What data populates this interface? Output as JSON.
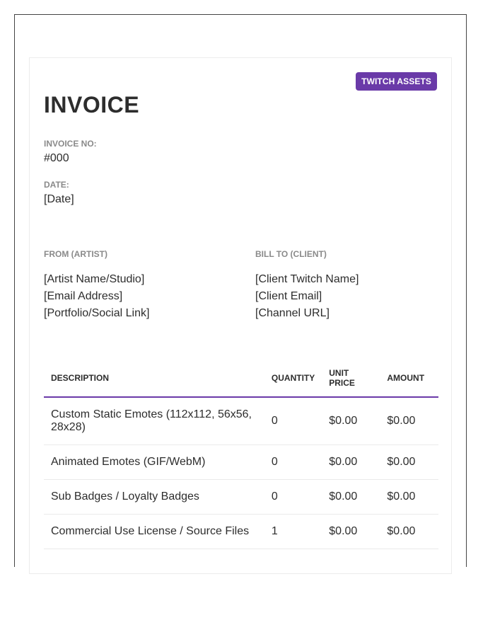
{
  "badge": "TWITCH ASSETS",
  "title": "INVOICE",
  "invoice_no": {
    "label": "INVOICE NO:",
    "value": "#000"
  },
  "date": {
    "label": "DATE:",
    "value": "[Date]"
  },
  "from": {
    "label": "FROM (ARTIST)",
    "lines": [
      "[Artist Name/Studio]",
      "[Email Address]",
      "[Portfolio/Social Link]"
    ]
  },
  "bill_to": {
    "label": "BILL TO (CLIENT)",
    "lines": [
      "[Client Twitch Name]",
      "[Client Email]",
      "[Channel URL]"
    ]
  },
  "table": {
    "headers": {
      "description": "DESCRIPTION",
      "quantity": "QUANTITY",
      "unit_price_1": "UNIT",
      "unit_price_2": "PRICE",
      "amount": "AMOUNT"
    },
    "rows": [
      {
        "description": "Custom Static Emotes (112x112, 56x56, 28x28)",
        "quantity": "0",
        "unit_price": "$0.00",
        "amount": "$0.00"
      },
      {
        "description": "Animated Emotes (GIF/WebM)",
        "quantity": "0",
        "unit_price": "$0.00",
        "amount": "$0.00"
      },
      {
        "description": "Sub Badges / Loyalty Badges",
        "quantity": "0",
        "unit_price": "$0.00",
        "amount": "$0.00"
      },
      {
        "description": "Commercial Use License / Source Files",
        "quantity": "1",
        "unit_price": "$0.00",
        "amount": "$0.00"
      }
    ]
  },
  "colors": {
    "accent": "#6a3aa8",
    "label_gray": "#8a8a8a",
    "text": "#2d2d2d"
  }
}
